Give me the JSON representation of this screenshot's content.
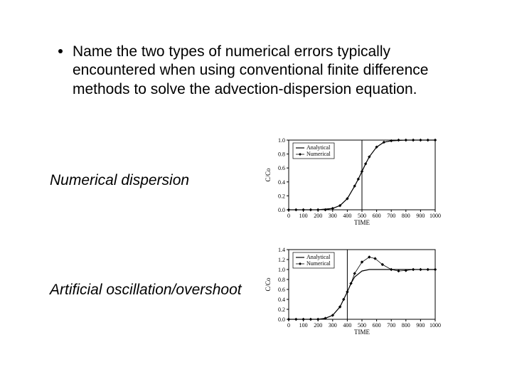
{
  "bullet": "Name the two types of numerical errors typically encountered when using conventional finite difference methods to solve the advection-dispersion equation.",
  "answers": {
    "a1": "Numerical dispersion",
    "a2": "Artificial oscillation/overshoot"
  },
  "chart_data": [
    {
      "type": "line",
      "title": "",
      "xlabel": "TIME",
      "ylabel": "C/Co",
      "xlim": [
        0,
        1000
      ],
      "ylim": [
        0.0,
        1.0
      ],
      "xticks": [
        0,
        100,
        200,
        300,
        400,
        500,
        600,
        700,
        800,
        900,
        1000
      ],
      "yticks": [
        0.0,
        0.2,
        0.4,
        0.6,
        0.8,
        1.0
      ],
      "legend_position": "upper-left",
      "front_marker_x": 500,
      "series": [
        {
          "name": "Analytical",
          "style": "line",
          "x": [
            0,
            100,
            200,
            300,
            350,
            400,
            450,
            475,
            500,
            525,
            550,
            600,
            650,
            700,
            800,
            900,
            1000
          ],
          "y": [
            0.0,
            0.0,
            0.0,
            0.02,
            0.06,
            0.16,
            0.34,
            0.44,
            0.55,
            0.66,
            0.76,
            0.9,
            0.97,
            0.99,
            1.0,
            1.0,
            1.0
          ]
        },
        {
          "name": "Numerical",
          "style": "markers",
          "x": [
            0,
            50,
            100,
            150,
            200,
            250,
            300,
            350,
            400,
            450,
            475,
            500,
            525,
            550,
            600,
            650,
            700,
            750,
            800,
            850,
            900,
            950,
            1000
          ],
          "y": [
            0.0,
            0.0,
            0.0,
            0.0,
            0.0,
            0.0,
            0.02,
            0.06,
            0.16,
            0.34,
            0.44,
            0.55,
            0.66,
            0.76,
            0.9,
            0.97,
            0.99,
            1.0,
            1.0,
            1.0,
            1.0,
            1.0,
            1.0
          ]
        }
      ]
    },
    {
      "type": "line",
      "title": "",
      "xlabel": "TIME",
      "ylabel": "C/Co",
      "xlim": [
        0,
        1000
      ],
      "ylim": [
        0.0,
        1.4
      ],
      "xticks": [
        0,
        100,
        200,
        300,
        400,
        500,
        600,
        700,
        800,
        900,
        1000
      ],
      "yticks": [
        0.0,
        0.2,
        0.4,
        0.6,
        0.8,
        1.0,
        1.2,
        1.4
      ],
      "legend_position": "upper-left",
      "front_marker_x": 400,
      "series": [
        {
          "name": "Analytical",
          "style": "line",
          "x": [
            0,
            100,
            200,
            250,
            300,
            350,
            375,
            400,
            425,
            450,
            500,
            550,
            600,
            700,
            800,
            900,
            1000
          ],
          "y": [
            0.0,
            0.0,
            0.0,
            0.02,
            0.08,
            0.25,
            0.4,
            0.55,
            0.72,
            0.85,
            0.97,
            1.0,
            1.0,
            1.0,
            1.0,
            1.0,
            1.0
          ]
        },
        {
          "name": "Numerical",
          "style": "markers",
          "x": [
            0,
            50,
            100,
            150,
            200,
            250,
            300,
            350,
            375,
            400,
            425,
            450,
            500,
            550,
            590,
            640,
            700,
            750,
            800,
            850,
            900,
            950,
            1000
          ],
          "y": [
            0.0,
            0.0,
            0.0,
            0.0,
            0.0,
            0.02,
            0.08,
            0.25,
            0.4,
            0.55,
            0.72,
            0.92,
            1.15,
            1.25,
            1.22,
            1.1,
            1.0,
            0.97,
            0.98,
            1.0,
            1.0,
            1.0,
            1.0
          ]
        }
      ]
    }
  ]
}
